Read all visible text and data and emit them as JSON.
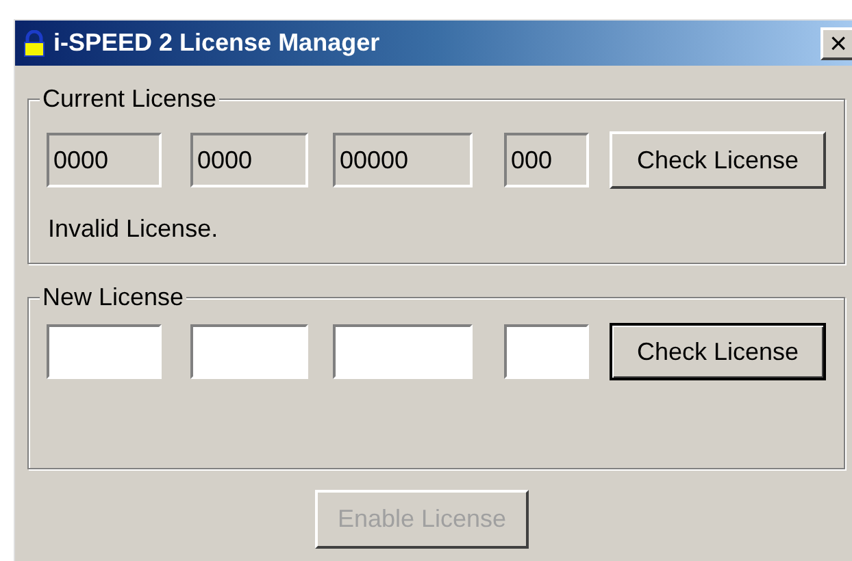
{
  "window": {
    "title": "i-SPEED 2 License Manager",
    "close": "×"
  },
  "groups": [
    {
      "title": "Current License",
      "fields": [
        {
          "value": "0000",
          "disabled": true
        },
        {
          "value": "0000",
          "disabled": true
        },
        {
          "value": "00000",
          "disabled": true
        },
        {
          "value": "000",
          "disabled": true
        }
      ],
      "button": {
        "label": "Check License",
        "default": false
      },
      "status": "Invalid License."
    },
    {
      "title": "New License",
      "fields": [
        {
          "disabled": false
        },
        {
          "disabled": false
        },
        {
          "disabled": false
        },
        {
          "disabled": false
        }
      ],
      "button": {
        "label": "Check License",
        "default": true
      }
    }
  ],
  "footer_button": {
    "label": "Enable License",
    "disabled": true
  }
}
